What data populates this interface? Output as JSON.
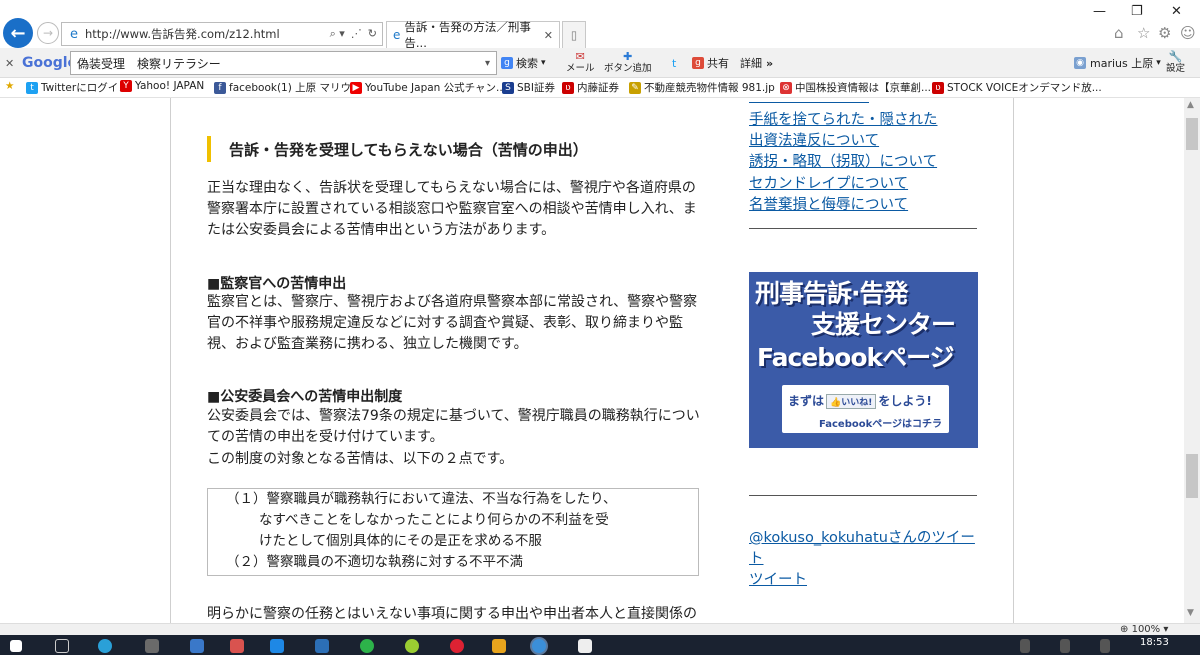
{
  "browser": {
    "address": "http://www.告訴告発.com/z12.html",
    "tab_title": "告訴・告発の方法／刑事告...",
    "tab_close": "✕",
    "back_glyph": "←",
    "forward_glyph": "→",
    "addr_controls": [
      "⌕ ▾",
      "⋰",
      "↻"
    ]
  },
  "window_controls": [
    "—",
    "❐",
    "✕"
  ],
  "top_right_icons": [
    "⌂",
    "☆",
    "⚙",
    "☺"
  ],
  "google_toolbar": {
    "close": "✕",
    "logo": "Google",
    "search_value": "偽装受理　検察リテラシー",
    "search_button": "検索",
    "mail": "メール",
    "add_button": "ボタン追加",
    "share": "共有",
    "details": "詳細",
    "more": "»",
    "user": "marius 上原",
    "settings": "設定"
  },
  "favorites": [
    {
      "label": "Twitterにログイン",
      "color": "#1da1f2",
      "glyph": "t"
    },
    {
      "label": "Yahoo! JAPAN",
      "color": "#d00",
      "glyph": "Y"
    },
    {
      "label": "facebook(1) 上原 マリウス",
      "color": "#3b5998",
      "glyph": "f"
    },
    {
      "label": "YouTube Japan 公式チャン...",
      "color": "#e00",
      "glyph": "▶"
    },
    {
      "label": "SBI証券",
      "color": "#1a3d8f",
      "glyph": "S"
    },
    {
      "label": "内藤証券",
      "color": "#c00",
      "glyph": "ʋ"
    },
    {
      "label": "不動産競売物件情報 981.jp",
      "color": "#c8a000",
      "glyph": "✎"
    },
    {
      "label": "中国株投資情報は【京華創...",
      "color": "#d33",
      "glyph": "⊗"
    },
    {
      "label": "STOCK VOICEオンデマンド放...",
      "color": "#c00",
      "glyph": "ʋ"
    }
  ],
  "content": {
    "heading": "告訴・告発を受理してもらえない場合（苦情の申出）",
    "intro": "正当な理由なく、告訴状を受理してもらえない場合には、警視庁や各道府県の警察署本庁に設置されている相談窓口や監察官室への相談や苦情申し入れ、または公安委員会による苦情申出という方法があります。",
    "sec1_title": "■監察官への苦情申出",
    "sec1_body": "監察官とは、警察庁、警視庁および各道府県警察本部に常設され、警察や警察官の不祥事や服務規定違反などに対する調査や賞疑、表彰、取り締まりや監視、および監査業務に携わる、独立した機関です。",
    "sec2_title": "■公安委員会への苦情申出制度",
    "sec2_body_1": "公安委員会では、警察法79条の規定に基づいて、警視庁職員の職務執行についての苦情の申出を受け付けています。",
    "sec2_body_2": "この制度の対象となる苦情は、以下の２点です。",
    "box_lines": [
      "（１）警察職員が職務執行において違法、不当な行為をしたり、",
      "なすべきことをしなかったことにより何らかの不利益を受",
      "けたとして個別具体的にその是正を求める不服",
      "（２）警察職員の不適切な執務に対する不平不満"
    ],
    "cut_line": "明らかに警察の任務とはいえない事項に関する申出や申出者本人と直接関係の"
  },
  "sidebar": {
    "links": [
      "手紙を捨てられた・隠された",
      "出資法違反について",
      "誘拐・略取（拐取）について",
      "セカンドレイプについて",
      "名誉棄損と侮辱について"
    ],
    "banner": {
      "line1": "刑事告訴·告発",
      "line2": "支援センター",
      "line3": "Facebookページ",
      "cta_a": "まずは",
      "cta_like": "👍いいね!",
      "cta_b": "をしよう!",
      "sub": "Facebookページはコチラ"
    },
    "tweets_link_1": "@kokuso_kokuhatuさんのツイー",
    "tweets_link_2": "ト",
    "tweet": "ツイート"
  },
  "status": {
    "zoom": "100%"
  },
  "taskbar": {
    "clock": "18:53"
  }
}
